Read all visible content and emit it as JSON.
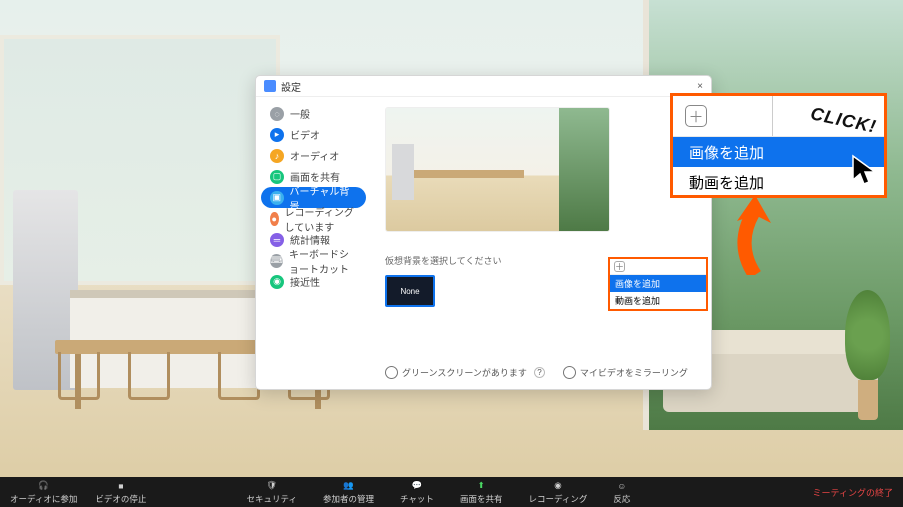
{
  "dialog": {
    "title": "設定",
    "close": "×",
    "sidebar": {
      "items": [
        {
          "label": "一般"
        },
        {
          "label": "ビデオ"
        },
        {
          "label": "オーディオ"
        },
        {
          "label": "画面を共有"
        },
        {
          "label": "バーチャル背景"
        },
        {
          "label": "レコーディングしています"
        },
        {
          "label": "統計情報"
        },
        {
          "label": "キーボードショートカット"
        },
        {
          "label": "接近性"
        }
      ]
    },
    "instruction": "仮想背景を選択してください",
    "thumb_none": "None",
    "add_icon": "＋",
    "checks": {
      "greenscreen": "グリーンスクリーンがあります",
      "mirror": "マイビデオをミラーリング"
    },
    "help": "?"
  },
  "small_popup": {
    "plus": "＋",
    "opt_image": "画像を追加",
    "opt_video": "動画を追加"
  },
  "callout": {
    "plus": "＋",
    "opt_image": "画像を追加",
    "opt_video": "動画を追加",
    "click_text": "CLICK!"
  },
  "toolbar": {
    "left": [
      {
        "label": "オーディオに参加"
      },
      {
        "label": "ビデオの停止"
      }
    ],
    "center": [
      {
        "label": "セキュリティ"
      },
      {
        "label": "参加者の管理"
      },
      {
        "label": "チャット"
      },
      {
        "label": "画面を共有",
        "green": true
      },
      {
        "label": "レコーディング"
      },
      {
        "label": "反応"
      }
    ],
    "end": "ミーティングの終了"
  },
  "colors": {
    "accent": "#0e72ed",
    "highlight": "#ff5a00"
  }
}
